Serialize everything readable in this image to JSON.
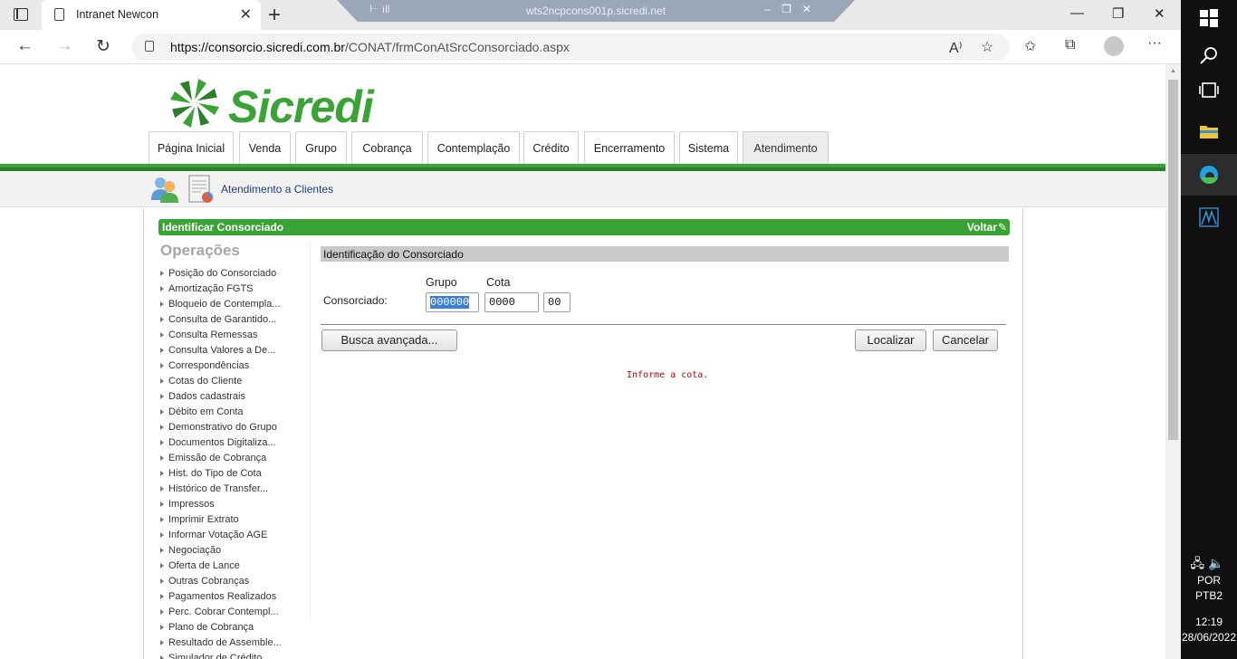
{
  "browser": {
    "tab_title": "Intranet Newcon",
    "rdp_host": "wts2ncpcons001p.sicredi.net",
    "url_host": "https://consorcio.sicredi.com.br",
    "url_path": "/CONAT/frmConAtSrcConsorciado.aspx"
  },
  "brand": {
    "name": "Sicredi",
    "color": "#3aa335"
  },
  "menu": {
    "tabs": [
      {
        "label": "Página Inicial"
      },
      {
        "label": "Venda"
      },
      {
        "label": "Grupo"
      },
      {
        "label": "Cobrança"
      },
      {
        "label": "Contemplação"
      },
      {
        "label": "Crédito"
      },
      {
        "label": "Encerramento"
      },
      {
        "label": "Sistema"
      },
      {
        "label": "Atendimento"
      }
    ],
    "active": "Atendimento"
  },
  "subnav": {
    "label": "Atendimento a Clientes"
  },
  "header": {
    "title": "Identificar Consorciado",
    "back_label": "Voltar"
  },
  "operations": {
    "title": "Operações",
    "items": [
      "Posição do Consorciado",
      "Amortização FGTS",
      "Bloqueio de Contempla...",
      "Consulta de Garantido...",
      "Consulta Remessas",
      "Consulta Valores a De...",
      "Correspondências",
      "Cotas do Cliente",
      "Dados cadastrais",
      "Débito em Conta",
      "Demonstrativo do Grupo",
      "Documentos Digitaliza...",
      "Emissão de Cobrança",
      "Hist. do Tipo de Cota",
      "Histórico de Transfer...",
      "Impressos",
      "Imprimir Extrato",
      "Informar Votação AGE",
      "Negociação",
      "Oferta de Lance",
      "Outras Cobranças",
      "Pagamentos Realizados",
      "Perc. Cobrar Contempl...",
      "Plano de Cobrança",
      "Resultado de Assemble...",
      "Simulador de Crédito"
    ]
  },
  "form": {
    "section_title": "Identificação do Consorciado",
    "row_label": "Consorciado:",
    "grupo_label": "Grupo",
    "cota_label": "Cota",
    "grupo_value": "000000",
    "cota_value": "0000",
    "digit_value": "00",
    "advanced_button": "Busca avançada...",
    "find_button": "Localizar",
    "cancel_button": "Cancelar",
    "error_message": "Informe a cota."
  },
  "system": {
    "lang_1": "POR",
    "lang_2": "PTB2",
    "time": "12:19",
    "date": "28/06/2022"
  }
}
